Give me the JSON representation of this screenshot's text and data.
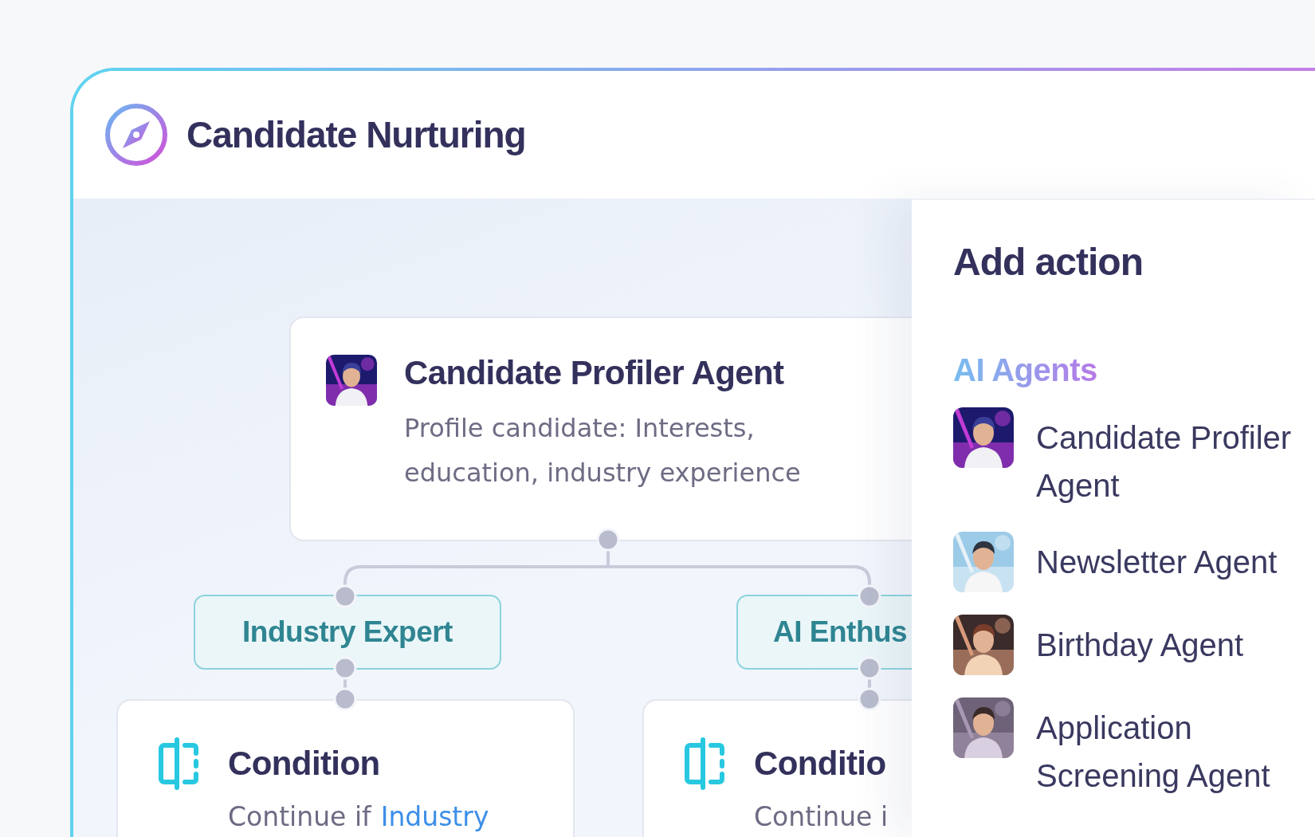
{
  "window": {
    "title": "Candidate Nurturing"
  },
  "canvas": {
    "agent_node": {
      "title": "Candidate Profiler Agent",
      "description": "Profile candidate: Interests, education, industry experience"
    },
    "branches": [
      {
        "tag": "Industry Expert",
        "condition": {
          "title": "Condition",
          "text": "Continue if",
          "highlight": "Industry"
        }
      },
      {
        "tag": "AI Enthus",
        "condition": {
          "title": "Conditio",
          "text": "Continue i"
        }
      }
    ]
  },
  "panel": {
    "title": "Add action",
    "section": "AI Agents",
    "agents": [
      {
        "name": "Candidate Profiler Agent"
      },
      {
        "name": "Newsletter Agent"
      },
      {
        "name": "Birthday Agent"
      },
      {
        "name": "Application Screening Agent"
      }
    ]
  }
}
